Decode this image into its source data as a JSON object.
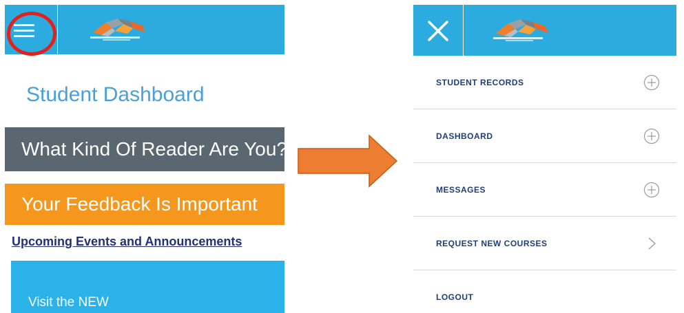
{
  "left_panel": {
    "page_title": "Student Dashboard",
    "banners": [
      {
        "text": "What Kind Of Reader Are You?",
        "color": "#5b6770"
      },
      {
        "text": "Your Feedback Is Important",
        "color": "#f5971d"
      }
    ],
    "events_link": "Upcoming Events and Announcements",
    "promo_text": "Visit the NEW"
  },
  "right_panel": {
    "menu_items": [
      {
        "label": "STUDENT RECORDS",
        "icon": "plus-circle-icon"
      },
      {
        "label": "DASHBOARD",
        "icon": "plus-circle-icon"
      },
      {
        "label": "MESSAGES",
        "icon": "plus-circle-icon"
      },
      {
        "label": "REQUEST NEW COURSES",
        "icon": "chevron-right-icon"
      },
      {
        "label": "LOGOUT",
        "icon": ""
      }
    ]
  },
  "colors": {
    "header_blue": "#2cacde",
    "highlight_red": "#e2211c",
    "arrow_orange": "#ed7d31",
    "title_blue": "#4a9fda",
    "menu_text": "#1e3e7a"
  }
}
